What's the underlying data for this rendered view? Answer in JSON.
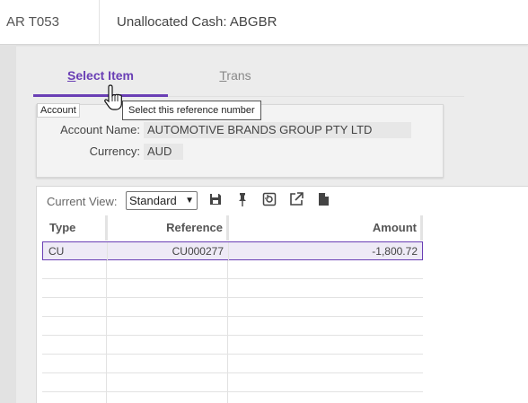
{
  "header": {
    "program_code": "AR T053",
    "title": "Unallocated Cash: ABGBR"
  },
  "tabs": {
    "select_item": "Select Item",
    "trans": "Trans"
  },
  "account": {
    "legend": "Account",
    "name_label": "Account Name:",
    "name_value": "AUTOMOTIVE BRANDS GROUP PTY LTD",
    "currency_label": "Currency:",
    "currency_value": "AUD"
  },
  "tooltip": "Select this reference number",
  "toolbar": {
    "view_label": "Current View:",
    "view_value": "Standard",
    "icons": [
      "save-icon",
      "pin-icon",
      "restore-icon",
      "external-link-icon",
      "document-icon"
    ]
  },
  "table": {
    "columns": [
      "Type",
      "Reference",
      "Amount"
    ],
    "rows": [
      {
        "type": "CU",
        "reference": "CU000277",
        "amount": "-1,800.72"
      }
    ]
  },
  "colors": {
    "accent": "#6a3fb5"
  }
}
